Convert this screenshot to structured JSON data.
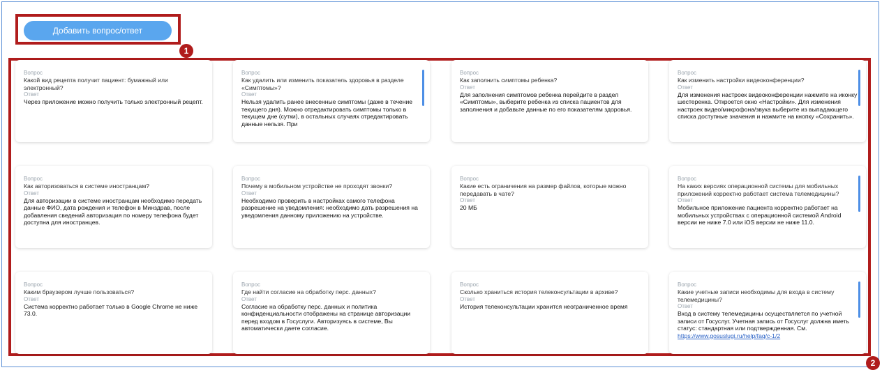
{
  "add_button": {
    "label": "Добавить вопрос/ответ"
  },
  "markers": {
    "m1": "1",
    "m2": "2"
  },
  "labels": {
    "question": "Вопрос",
    "answer": "Ответ"
  },
  "cards": [
    {
      "question": "Какой вид рецепта получит пациент: бумажный или электронный?",
      "answer": "Через приложение можно получить только электронный рецепт."
    },
    {
      "question": "Как удалить или изменить показатель здоровья в разделе «Симптомы»?",
      "answer": "Нельзя удалить ранее внесенные симптомы (даже в течение текущего дня). Можно отредактировать симптомы только в текущем дне (сутки), в остальных случаях отредактировать данные нельзя. При"
    },
    {
      "question": "Как заполнить симптомы ребенка?",
      "answer": "Для заполнения симптомов ребенка перейдите в раздел «Симптомы», выберите ребенка из списка пациентов для заполнения и добавьте данные по его показателям здоровья."
    },
    {
      "question": "Как изменить настройки видеоконференции?",
      "answer": "Для изменения настроек видеоконференции нажмите на иконку шестеренка. Откроется окно «Настройки». Для изменения настроек видео/микрофона/звука выберите из выпадающего списка доступные значения и нажмите на кнопку «Сохранить»."
    },
    {
      "question": "Как авторизоваться в системе иностранцам?",
      "answer": "Для авторизации в системе иностранцам необходимо передать данные ФИО, дата рождения и телефон в Минздрав, после добавления сведений авторизация по номеру телефона будет доступна для иностранцев."
    },
    {
      "question": "Почему в мобильном устройстве не проходят звонки?",
      "answer": "Необходимо проверить в настройках самого телефона разрешение на уведомления: необходимо дать разрешения на уведомления данному приложению на устройстве."
    },
    {
      "question": "Какие есть ограничения на размер файлов, которые можно передавать в чате?",
      "answer": "20 МБ"
    },
    {
      "question": "На каких версиях операционной системы для мобильных приложений корректно работает система телемедицины?",
      "answer": "Мобильное приложение пациента корректно работает на мобильных устройствах с операционной системой Android версии не ниже 7.0 или iOS версии не ниже 11.0."
    },
    {
      "question": "Каким браузером лучше пользоваться?",
      "answer": "Система корректно работает только в Google Chrome не ниже 73.0."
    },
    {
      "question": "Где найти согласие на обработку перс. данных?",
      "answer": "Согласие на обработку перс. данных и политика конфиденциальности отображены на странице авторизации перед входом в Госуслуги. Авторизуясь в системе, Вы автоматически даете согласие."
    },
    {
      "question": "Сколько храниться история телеконсультации в архиве?",
      "answer": "История телеконсультации хранится неограниченное время"
    },
    {
      "question": "Какие учетные записи необходимы для входа в систему телемедицины?",
      "answer": "Вход в систему телемедицины осуществляется по учетной записи от Госуслуг. Учетная запись от Госуслуг должна иметь статус: стандартная или подтвержденная. См.",
      "link": "https://www.gosuslugi.ru/help/faq/c-1/2"
    }
  ]
}
